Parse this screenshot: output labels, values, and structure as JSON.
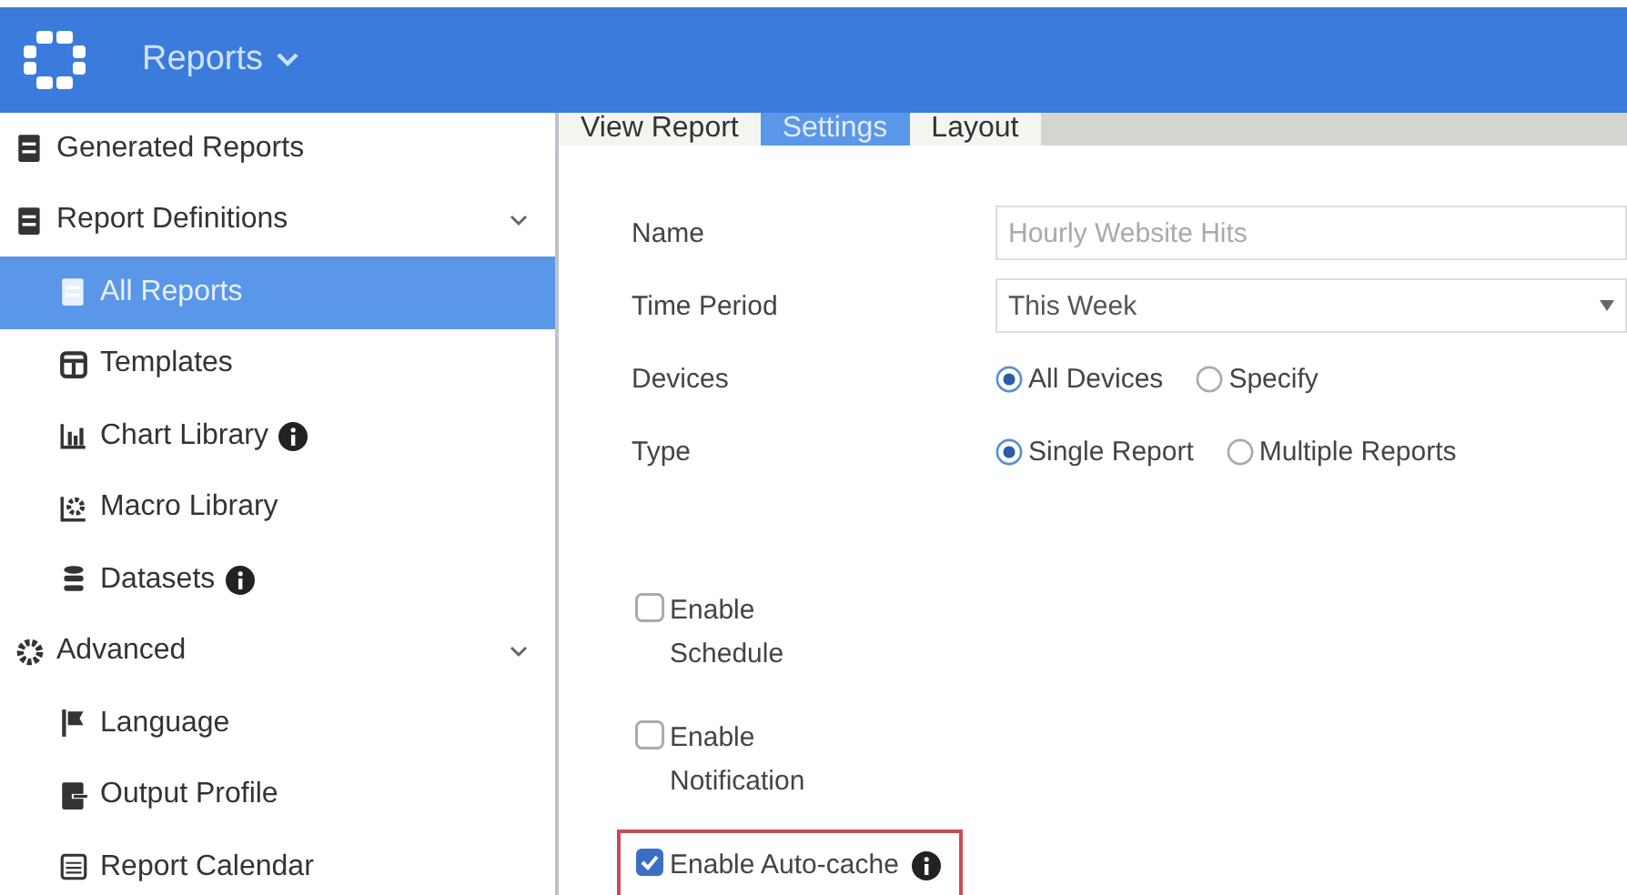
{
  "header": {
    "title": "Reports"
  },
  "sidebar": {
    "items": [
      {
        "label": "Generated Reports",
        "selected": false,
        "info": false
      },
      {
        "label": "Report Definitions",
        "selected": false,
        "info": false,
        "expanded": true,
        "children": [
          {
            "label": "All Reports",
            "selected": true,
            "info": false
          },
          {
            "label": "Templates",
            "selected": false,
            "info": false
          },
          {
            "label": "Chart Library",
            "selected": false,
            "info": true
          },
          {
            "label": "Macro Library",
            "selected": false,
            "info": false
          },
          {
            "label": "Datasets",
            "selected": false,
            "info": true
          }
        ]
      },
      {
        "label": "Advanced",
        "selected": false,
        "info": false,
        "expanded": true,
        "children": [
          {
            "label": "Language",
            "selected": false,
            "info": false
          },
          {
            "label": "Output Profile",
            "selected": false,
            "info": false
          },
          {
            "label": "Report Calendar",
            "selected": false,
            "info": false
          }
        ]
      }
    ]
  },
  "tabs": [
    {
      "label": "View Report",
      "selected": false
    },
    {
      "label": "Settings",
      "selected": true
    },
    {
      "label": "Layout",
      "selected": false
    }
  ],
  "form": {
    "fields": [
      {
        "kind": "text",
        "label": "Name",
        "value": "Hourly Website Hits"
      },
      {
        "kind": "select",
        "label": "Time Period",
        "value": "This Week"
      },
      {
        "kind": "radio",
        "label": "Devices",
        "options": [
          {
            "label": "All Devices",
            "selected": true
          },
          {
            "label": "Specify",
            "selected": false
          }
        ]
      },
      {
        "kind": "radio",
        "label": "Type",
        "options": [
          {
            "label": "Single Report",
            "selected": true
          },
          {
            "label": "Multiple Reports",
            "selected": false
          }
        ]
      }
    ],
    "checkboxes": [
      {
        "label": "Enable Schedule",
        "checked": false,
        "info": false,
        "highlighted": false
      },
      {
        "label": "Enable Notification",
        "checked": false,
        "info": false,
        "highlighted": false
      },
      {
        "label": "Enable Auto-cache",
        "checked": true,
        "info": true,
        "highlighted": true
      }
    ]
  }
}
